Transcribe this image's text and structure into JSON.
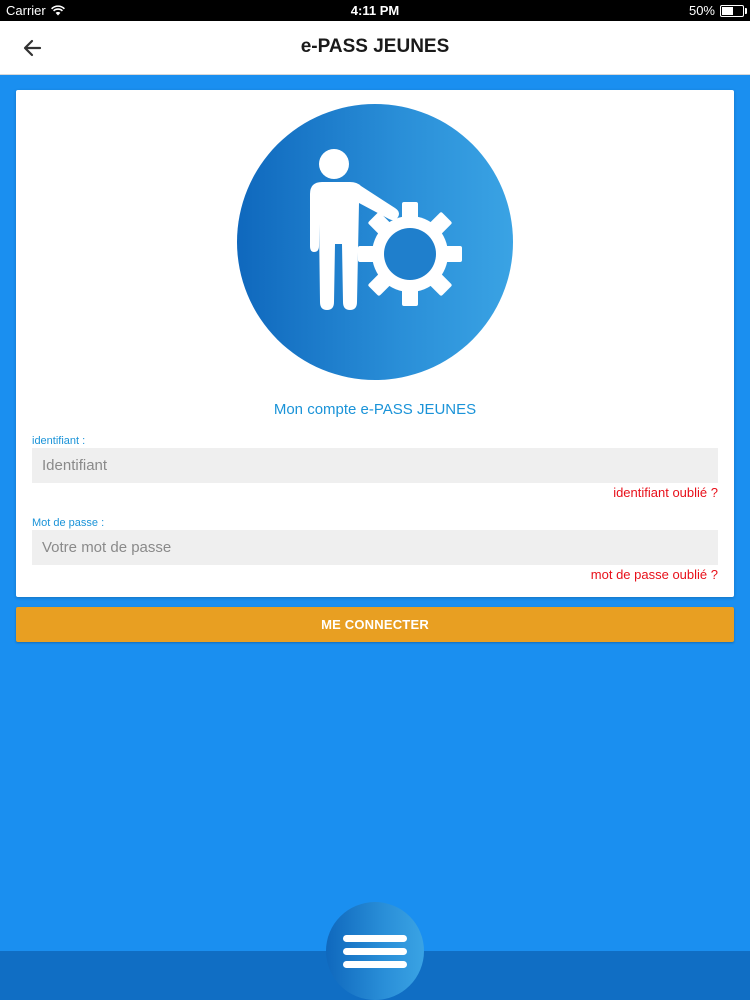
{
  "status_bar": {
    "carrier": "Carrier",
    "wifi_icon": "wifi-icon",
    "time": "4:11 PM",
    "battery_percent": "50%",
    "battery_level": 0.5
  },
  "nav": {
    "back_icon": "arrow-left-icon",
    "title": "e-PASS JEUNES"
  },
  "card": {
    "illustration_icon": "person-gear-icon",
    "title": "Mon compte e-PASS JEUNES",
    "username": {
      "label": "identifiant :",
      "placeholder": "Identifiant",
      "value": "",
      "forgot_link": "identifiant oublié ?"
    },
    "password": {
      "label": "Mot de passe :",
      "placeholder": "Votre mot de passe",
      "value": "",
      "forgot_link": "mot de passe oublié ?"
    }
  },
  "connect_button": {
    "label": "ME CONNECTER"
  },
  "bottom": {
    "menu_icon": "hamburger-menu-icon"
  },
  "colors": {
    "background": "#1a8ff0",
    "accent_blue": "#1a93d8",
    "button_orange": "#e89f22",
    "link_red": "#e8101a",
    "bottom_bar": "#106ec4"
  }
}
